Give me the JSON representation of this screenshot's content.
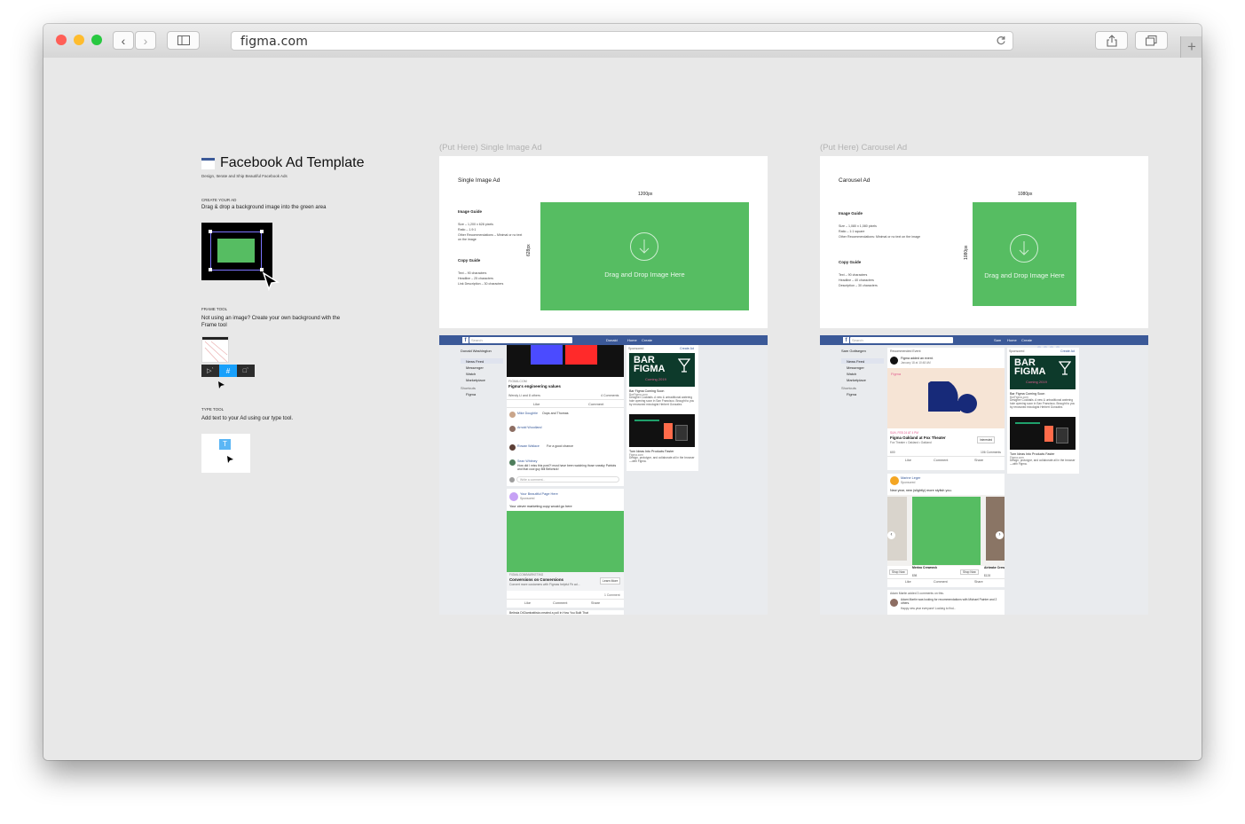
{
  "browser": {
    "url": "figma.com",
    "colors": {
      "close": "#ff5f57",
      "minimize": "#febc2e",
      "zoom": "#28c840"
    },
    "icons": [
      "back-icon",
      "forward-icon",
      "sidebar-icon",
      "reload-icon",
      "share-icon",
      "tabs-icon",
      "new-tab-icon"
    ]
  },
  "guide": {
    "title": "Facebook Ad Template",
    "subtitle": "Design, Iterate and Ship Beautiful Facebook Ads",
    "create_heading": "CREATE YOUR AD",
    "create_text": "Drag & drop a background image into the green area",
    "frame_heading": "FRAME TOOL",
    "frame_text": "Not using an image?  Create your own background with the Frame tool",
    "type_heading": "TYPE TOOL",
    "type_text": "Add text to your Ad using our type tool."
  },
  "single": {
    "frame_label": "(Put Here) Single Image Ad",
    "heading": "Single Image Ad",
    "width_label": "1200px",
    "height_label": "628px",
    "image_guide_title": "Image Guide",
    "image_guide_lines": [
      "Size – 1,200 x 628 pixels",
      "Ratio – 1.9:1",
      "Other Recommendations – Minimal or no text",
      "on the image"
    ],
    "copy_guide_title": "Copy Guide",
    "copy_guide_lines": [
      "Text – 90 characters",
      "Headline – 25 characters",
      "Link Description – 30 characters"
    ],
    "drop_text": "Drag and Drop Image Here",
    "feed": {
      "user": "Donald Washington",
      "left_nav": [
        "News Feed",
        "Messenger",
        "Watch",
        "Marketplace"
      ],
      "shortcuts_title": "Shortcuts",
      "shortcut": "Figma",
      "top_nav": [
        "Donald",
        "Home",
        "Create"
      ],
      "search_placeholder": "Search",
      "post_source": "FIGMA.COM",
      "post_title": "Figma's engineering values",
      "reactions": "Wendy Li and 8 others",
      "comments_count": "4 Comments",
      "like": "Like",
      "comment": "Comment",
      "share": "Share",
      "comments": [
        {
          "name": "Mike Doughtie",
          "text": "Oops and Thomas"
        },
        {
          "name": "Arnold Woodland",
          "text": ""
        },
        {
          "name": "Rowan Wallace",
          "text": "For a good chance"
        },
        {
          "name": "Sean Whitney",
          "text": "How did I miss this post?! must have been watching those sneaky Patriots and that cool guy Bill Belichick!"
        }
      ],
      "write_comment": "Write a comment...",
      "ad_page": "Your Beautiful Page Here",
      "ad_sponsored": "Sponsored",
      "ad_copy": "Your clever marketing copy would go here",
      "ad_domain": "FIGMA.COM/MARKETING",
      "ad_headline": "Conversions on Conversions",
      "ad_desc": "Convert more customers with Figmas helpful Fb ad...",
      "ad_cta": "Learn More",
      "ad_comment_count": "1 Comment",
      "next_post": "Belinda DiGiambattista created a poll in How You Built That",
      "sponsored_title": "Sponsored",
      "create_ad": "Create Ad",
      "bar_word1": "BAR",
      "bar_word2": "FIGMA",
      "bar_coming": "Coming 2019",
      "bar_title": "Bar Figma Coming Soon",
      "bar_domain": "BarFigma.com",
      "bar_desc": "Designer Cocktails. A new & untraditional watering hole opening soon in San Francisco. Brought to you by renowned mixologist Herbert Gonzalez.",
      "turn_title": "Turn Ideas Into Products Faster",
      "turn_domain": "Figma.com",
      "turn_desc": "Design, prototype, and collaborate all in the browser—with Figma."
    }
  },
  "carousel": {
    "frame_label": "(Put Here) Carousel Ad",
    "heading": "Carousel Ad",
    "width_label": "1080px",
    "height_label": "1080px",
    "image_guide_title": "Image Guide",
    "image_guide_lines": [
      "Size – 1,080 x 1,080 pixels",
      "Ratio – 1:1 square",
      "Other Recommendations: Minimal or no text on the image"
    ],
    "copy_guide_title": "Copy Guide",
    "copy_guide_lines": [
      "Text – 90 characters",
      "Headline – 40 characters",
      "Description – 30 characters"
    ],
    "drop_text": "Drag and Drop Image Here",
    "feed": {
      "user": "Sam Gottsegen",
      "top_nav": [
        "Sam",
        "Home",
        "Create"
      ],
      "search_placeholder": "Search",
      "recommended": "Recommended Event",
      "event_host": "Figma added an event.",
      "event_date_line": "January 18 at 10:48 AM",
      "event_brand": "Figma",
      "event_time": "SUN, FEB 24 AT 4 PM",
      "event_title": "Figma Oakland at Fox Theater",
      "event_place": "Fox Theater • Oakland • Oakland",
      "interested": "Interested",
      "event_comments": "106 Comments",
      "reactions": "600",
      "ad_page": "Marine Leger",
      "ad_sponsored": "Sponsored",
      "ad_copy": "New year, new (slightly) more stylish you.",
      "card1_title": "Merino Crewneck",
      "card1_price": "$98",
      "card2_title": "Airbrake Crew",
      "card2_price": "$128",
      "shop_now": "Shop Now",
      "like": "Like",
      "comment": "Comment",
      "share": "Share",
      "activity": "Adam Martin added 3 comments on this.",
      "rec_text": "Adam Martin was looking for recommendations with Michael Painter and 2 others.",
      "rec_text2": "Happy new year everyone! Looking to find..."
    }
  }
}
